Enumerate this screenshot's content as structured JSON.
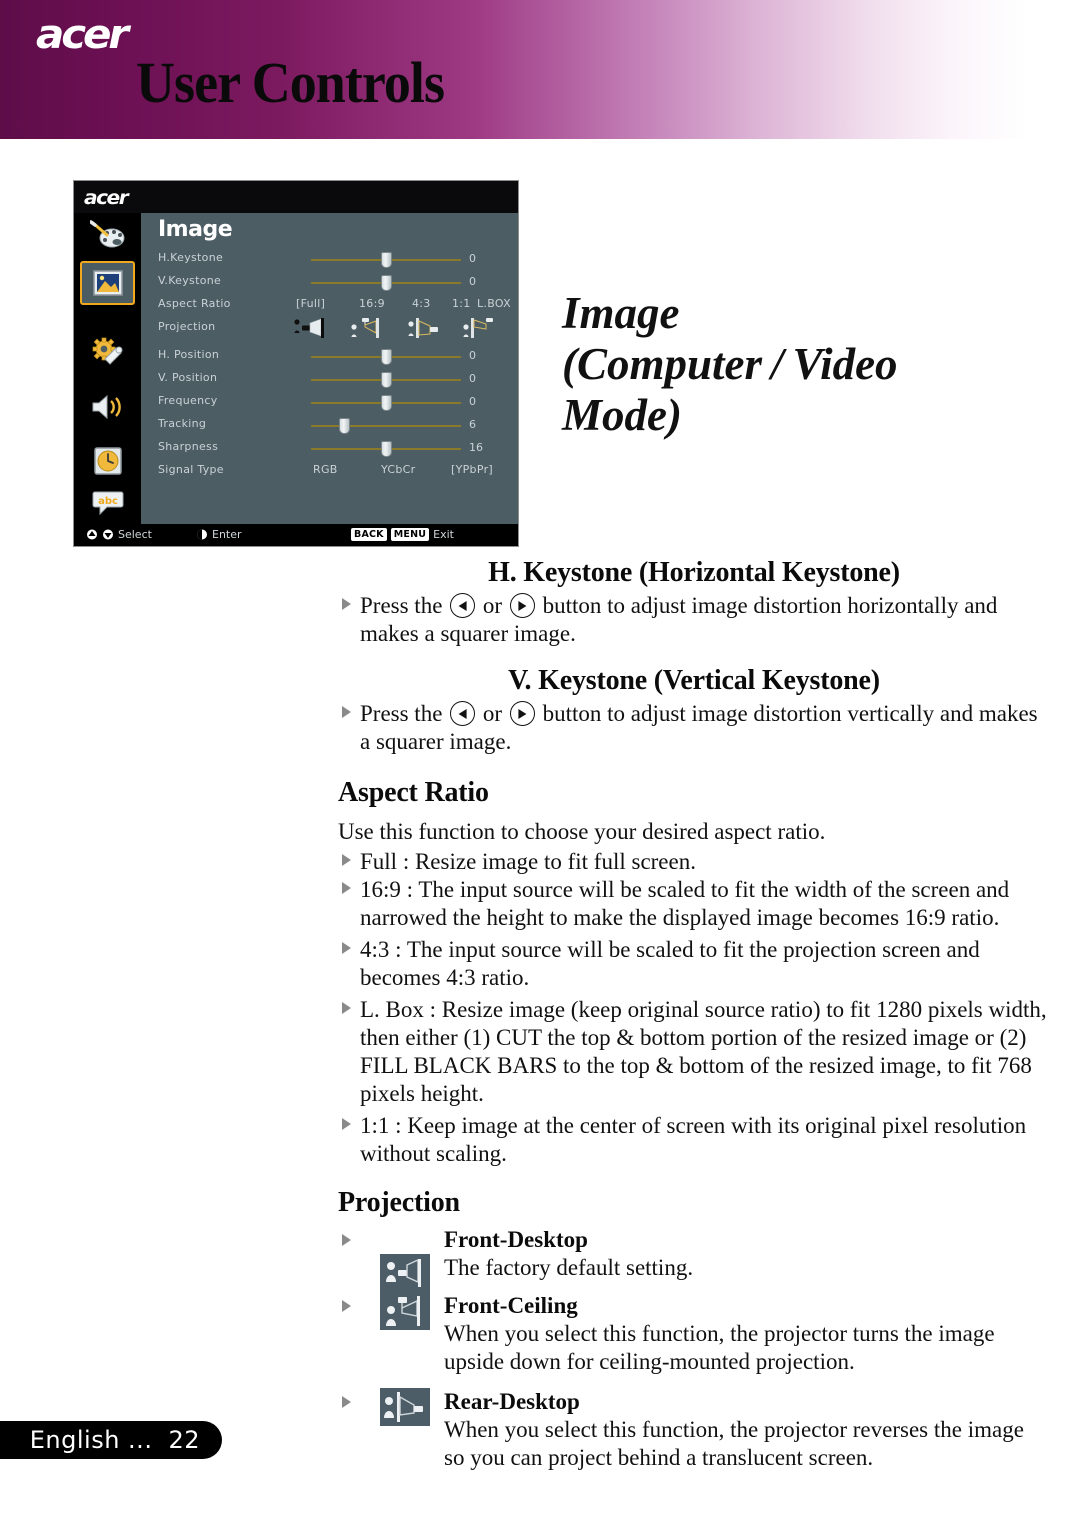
{
  "header": {
    "brand": "acer",
    "title": "User Controls"
  },
  "osd": {
    "brand": "acer",
    "menu_title": "Image",
    "sidebar": [
      {
        "name": "color-palette",
        "label": "Color"
      },
      {
        "name": "image",
        "label": "Image"
      },
      {
        "name": "settings",
        "label": "Management"
      },
      {
        "name": "audio",
        "label": "Audio"
      },
      {
        "name": "timer",
        "label": "Timer"
      },
      {
        "name": "language",
        "label": "Language"
      }
    ],
    "selected_sidebar_index": 1,
    "rows": [
      {
        "label": "H.Keystone",
        "type": "slider",
        "value": "0",
        "pos": 50
      },
      {
        "label": "V.Keystone",
        "type": "slider",
        "value": "0",
        "pos": 50
      },
      {
        "label": "Aspect Ratio",
        "type": "options",
        "options": [
          "[Full]",
          "16:9",
          "4:3",
          "1:1",
          "L.BOX"
        ],
        "selected": "[Full]"
      },
      {
        "label": "Projection",
        "type": "icons",
        "options": [
          "front-desktop",
          "front-ceiling",
          "rear-desktop",
          "rear-ceiling"
        ],
        "selected": "front-desktop"
      },
      {
        "label": "H. Position",
        "type": "slider",
        "value": "0",
        "pos": 50
      },
      {
        "label": "V. Position",
        "type": "slider",
        "value": "0",
        "pos": 50
      },
      {
        "label": "Frequency",
        "type": "slider",
        "value": "0",
        "pos": 50
      },
      {
        "label": "Tracking",
        "type": "slider",
        "value": "6",
        "pos": 22
      },
      {
        "label": "Sharpness",
        "type": "slider",
        "value": "16",
        "pos": 50
      },
      {
        "label": "Signal Type",
        "type": "options",
        "options": [
          "RGB",
          "YCbCr",
          "[YPbPr]"
        ],
        "selected": "[YPbPr]"
      }
    ],
    "bottom_bar": {
      "select_label": "Select",
      "enter_label": "Enter",
      "back_key": "BACK",
      "menu_key": "MENU",
      "exit_label": "Exit"
    },
    "colors": {
      "panel_bg": "#4d5d64",
      "sidebar_bg": "#000000",
      "highlight": "#f0a81e",
      "slider_track": "#8a7a2a",
      "label_text": "#c9d2d6"
    }
  },
  "side_title": "Image\n(Computer / Video Mode)",
  "sections": {
    "hkeystone": {
      "heading": "H. Keystone (Horizontal Keystone)",
      "bullet_pre": "Press the",
      "bullet_mid": "or",
      "bullet_post": "button to adjust image distortion horizontally and makes a squarer image."
    },
    "vkeystone": {
      "heading": "V. Keystone (Vertical Keystone)",
      "bullet_pre": "Press the",
      "bullet_mid": "or",
      "bullet_post": "button to adjust image distortion vertically and makes a squarer image."
    },
    "aspect_ratio": {
      "heading": "Aspect Ratio",
      "intro": "Use this function to choose your desired aspect ratio.",
      "items": [
        {
          "term": "Full :",
          "text": "Resize image to fit full screen."
        },
        {
          "term": "16:9 :",
          "text": "The input source will be scaled to fit the width of the screen and narrowed the height to make the displayed image becomes 16:9 ratio."
        },
        {
          "term": "4:3 :",
          "text": "The input source will be scaled to fit the projection screen and becomes 4:3 ratio."
        },
        {
          "term": "L. Box :",
          "text": "Resize image (keep original source ratio) to fit 1280 pixels width, then either (1) CUT the top & bottom portion of the resized image or (2) FILL BLACK BARS to the top & bottom of the resized image, to fit 768 pixels height."
        },
        {
          "term": "1:1 :",
          "text": "Keep image at the center of screen with its original pixel resolution without scaling."
        }
      ]
    },
    "projection": {
      "heading": "Projection",
      "items": [
        {
          "icon": "front-desktop-icon",
          "name": "Front-Desktop",
          "desc": "The factory default setting."
        },
        {
          "icon": "front-ceiling-icon",
          "name": "Front-Ceiling",
          "desc": "When you select this function, the projector turns the image upside down for ceiling-mounted projection."
        },
        {
          "icon": "rear-desktop-icon",
          "name": "Rear-Desktop",
          "desc": "When you select this function, the projector reverses the image so you can project behind a translucent screen."
        }
      ]
    }
  },
  "footer": {
    "language": "English ...",
    "page": "22"
  }
}
